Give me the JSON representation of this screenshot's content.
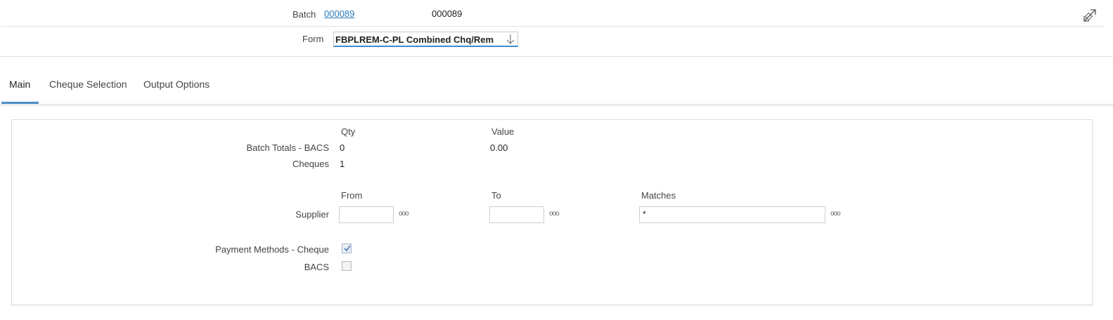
{
  "header": {
    "batch_label": "Batch",
    "batch_link": "000089",
    "batch_value": "000089",
    "form_label": "Form",
    "form_selected": "FBPLREM-C-PL Combined Chq/Rem"
  },
  "tabs": [
    {
      "label": "Main",
      "active": true
    },
    {
      "label": "Cheque Selection",
      "active": false
    },
    {
      "label": "Output Options",
      "active": false
    }
  ],
  "totals": {
    "qty_header": "Qty",
    "value_header": "Value",
    "rows": [
      {
        "label": "Batch Totals - BACS",
        "qty": "0",
        "value": "0.00"
      },
      {
        "label": "Cheques",
        "qty": "1",
        "value": ""
      }
    ]
  },
  "supplier": {
    "label": "Supplier",
    "from_header": "From",
    "to_header": "To",
    "matches_header": "Matches",
    "from_value": "",
    "to_value": "",
    "matches_value": "*",
    "lookup_glyph": "ooo"
  },
  "payment_methods": [
    {
      "label": "Payment Methods - Cheque",
      "checked": true
    },
    {
      "label": "BACS",
      "checked": false
    }
  ],
  "colors": {
    "accent": "#4b8fc9",
    "link": "#2a7ab8"
  },
  "icons": {
    "expand": "expand-arrows-icon",
    "dropdown": "chevron-down-icon",
    "lookup": "lookup-dots-icon"
  }
}
